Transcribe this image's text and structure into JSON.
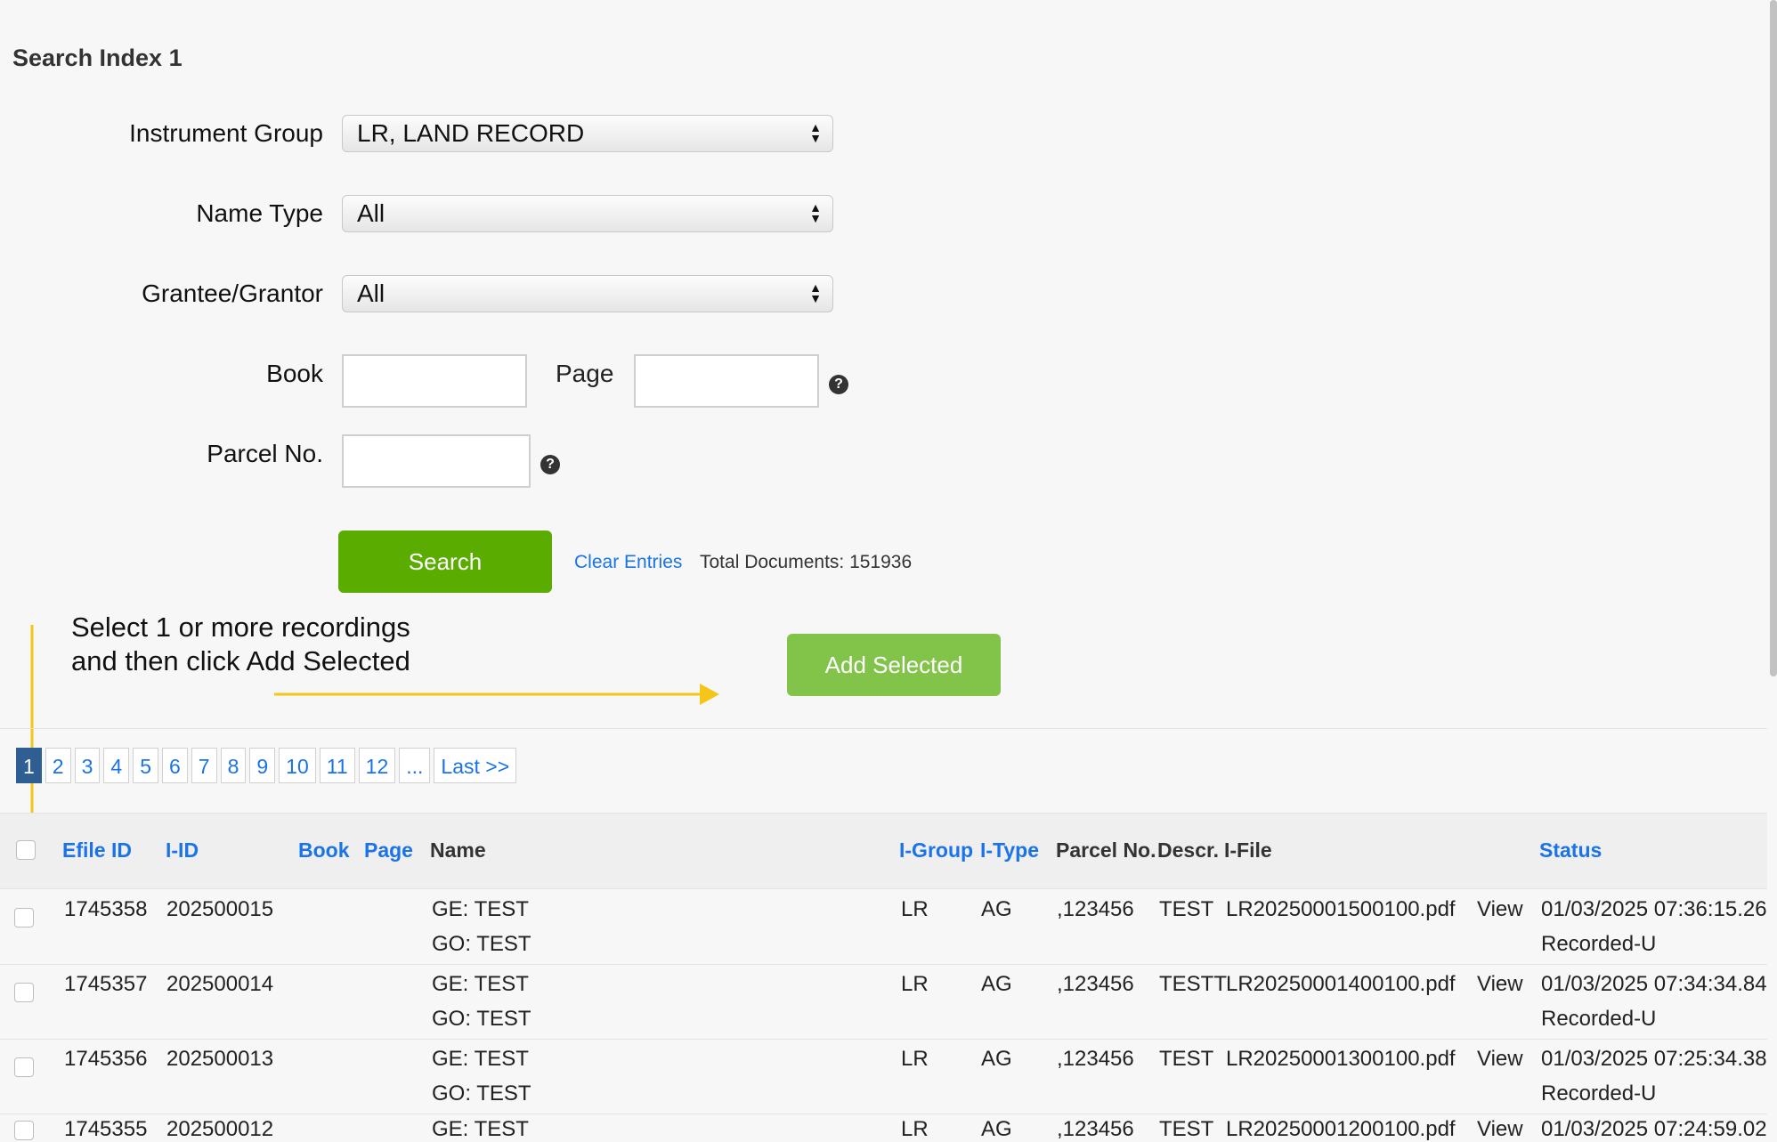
{
  "form": {
    "title": "Search Index 1",
    "instrument_group": {
      "label": "Instrument Group",
      "value": "LR, LAND RECORD"
    },
    "name_type": {
      "label": "Name Type",
      "value": "All"
    },
    "grantee_grantor": {
      "label": "Grantee/Grantor",
      "value": "All"
    },
    "book": {
      "label": "Book",
      "value": ""
    },
    "page": {
      "label": "Page",
      "value": ""
    },
    "parcel_no": {
      "label": "Parcel No.",
      "value": ""
    },
    "search_label": "Search",
    "clear_label": "Clear Entries",
    "total_docs": "Total Documents: 151936"
  },
  "hint": {
    "text": "Select 1 or more recordings and then click Add Selected"
  },
  "add_selected_label": "Add Selected",
  "pager": {
    "pages": [
      "1",
      "2",
      "3",
      "4",
      "5",
      "6",
      "7",
      "8",
      "9",
      "10",
      "11",
      "12",
      "..."
    ],
    "last_label": "Last >>",
    "current": "1"
  },
  "table": {
    "headers": {
      "efile": "Efile ID",
      "iid": "I-ID",
      "book": "Book",
      "page": "Page",
      "name": "Name",
      "igroup": "I-Group",
      "itype": "I-Type",
      "parcel": "Parcel No.",
      "descr": "Descr.",
      "ifile": "I-File",
      "status": "Status"
    },
    "rows": [
      {
        "efile": "1745358",
        "iid": "202500015",
        "ge": "GE: TEST",
        "go": "GO: TEST",
        "igroup": "LR",
        "itype": "AG",
        "parcel": ",123456",
        "descr": "TEST",
        "ifile": "LR20250001500100.pdf",
        "view": "View",
        "date": "01/03/2025 07:36:15.26",
        "status": "Recorded-U"
      },
      {
        "efile": "1745357",
        "iid": "202500014",
        "ge": "GE: TEST",
        "go": "GO: TEST",
        "igroup": "LR",
        "itype": "AG",
        "parcel": ",123456",
        "descr": "TESTT",
        "ifile": "LR20250001400100.pdf",
        "view": "View",
        "date": "01/03/2025 07:34:34.84",
        "status": "Recorded-U"
      },
      {
        "efile": "1745356",
        "iid": "202500013",
        "ge": "GE: TEST",
        "go": "GO: TEST",
        "igroup": "LR",
        "itype": "AG",
        "parcel": ",123456",
        "descr": "TEST",
        "ifile": "LR20250001300100.pdf",
        "view": "View",
        "date": "01/03/2025 07:25:34.38",
        "status": "Recorded-U"
      },
      {
        "efile": "1745355",
        "iid": "202500012",
        "ge": "GE: TEST",
        "go": "",
        "igroup": "LR",
        "itype": "AG",
        "parcel": ",123456",
        "descr": "TEST",
        "ifile": "LR20250001200100.pdf",
        "view": "View",
        "date": "01/03/2025 07:24:59.02",
        "status": ""
      }
    ]
  },
  "colors": {
    "accent_green": "#5aac00",
    "add_green": "#82c34a",
    "link_blue": "#1a73e8",
    "arrow_yellow": "#f5c518",
    "pager_active": "#2f5e93"
  }
}
